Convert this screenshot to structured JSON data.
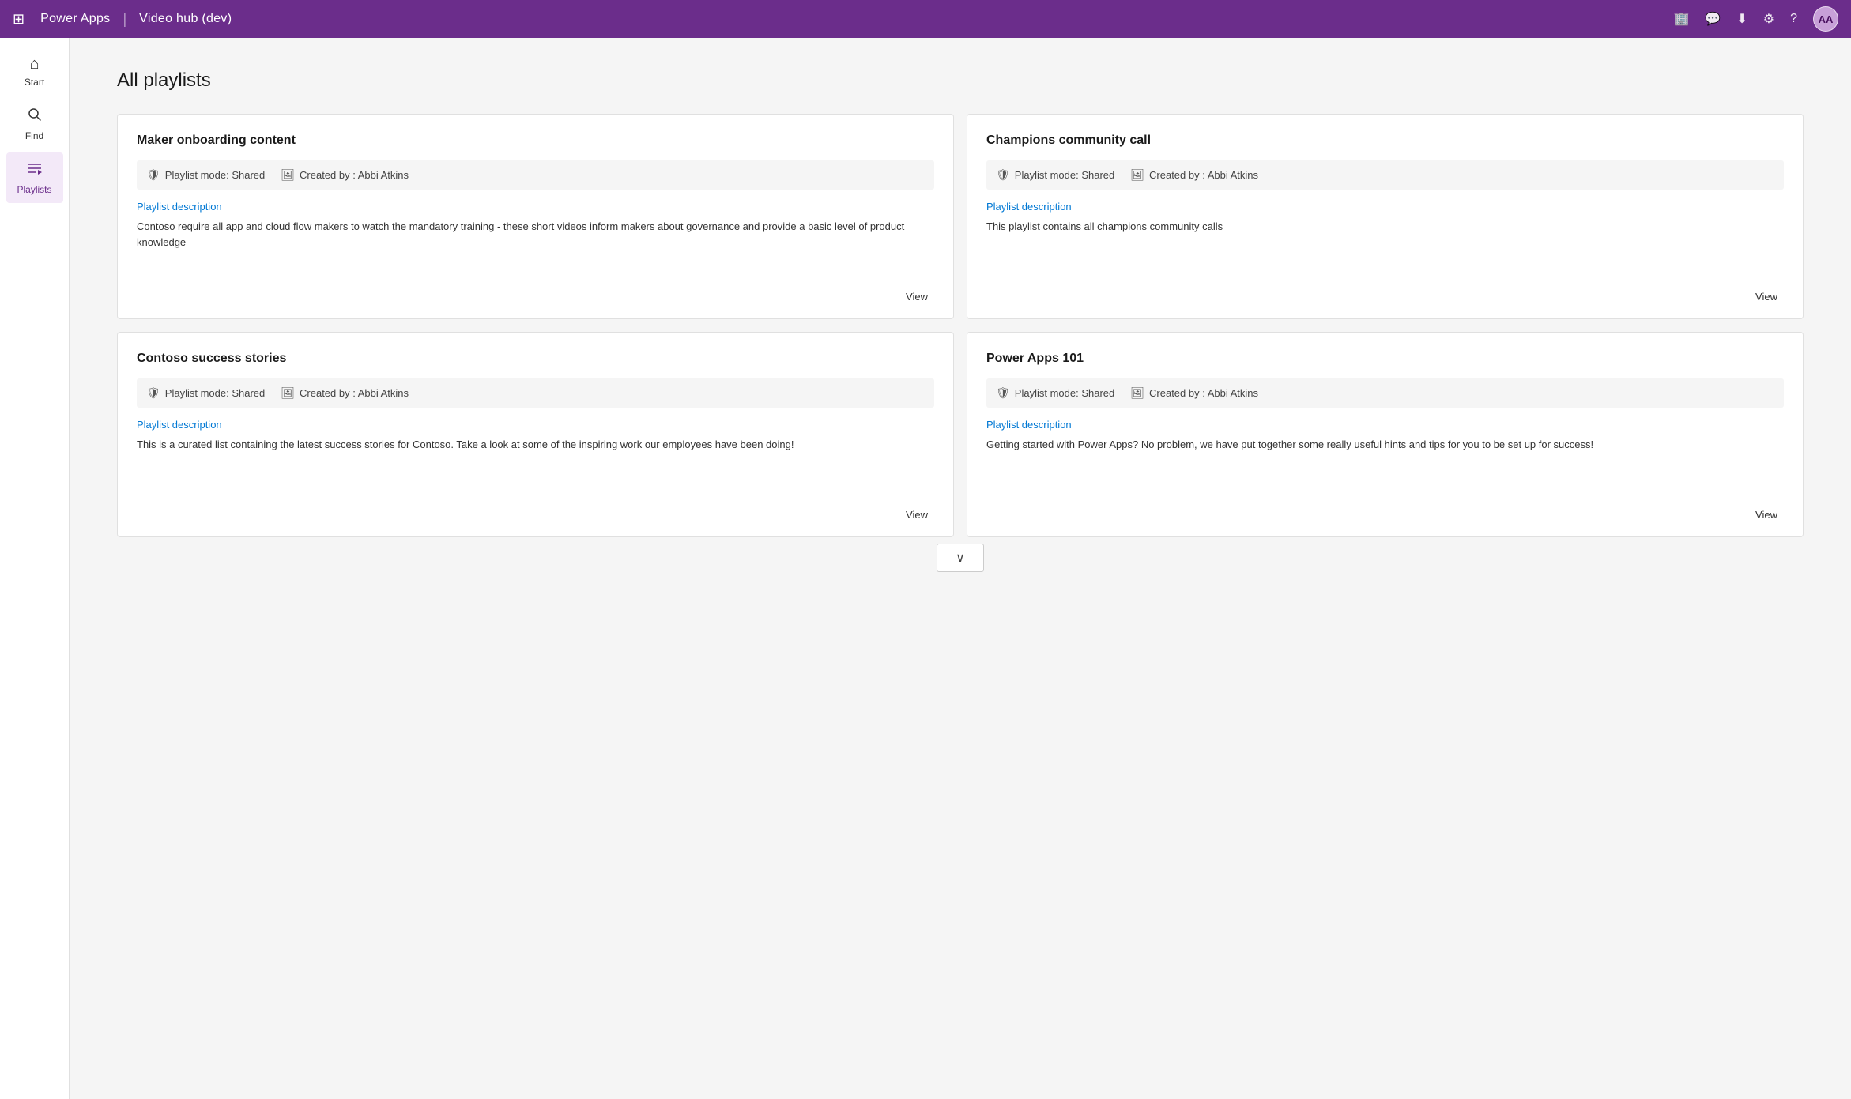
{
  "topnav": {
    "waffle_icon": "⊞",
    "app_name": "Power Apps",
    "separator": "|",
    "app_context": "Video hub (dev)",
    "icons": {
      "environment": "🏢",
      "chat": "💬",
      "download": "⬇",
      "settings": "⚙",
      "help": "?"
    },
    "avatar_label": "AA"
  },
  "sidebar": {
    "items": [
      {
        "id": "start",
        "label": "Start",
        "icon": "⌂",
        "active": false
      },
      {
        "id": "find",
        "label": "Find",
        "icon": "🔍",
        "active": false
      },
      {
        "id": "playlists",
        "label": "Playlists",
        "icon": "☰",
        "active": true
      }
    ]
  },
  "main": {
    "page_title": "All playlists",
    "playlists": [
      {
        "id": "maker-onboarding",
        "title": "Maker onboarding content",
        "playlist_mode_label": "Playlist mode: Shared",
        "created_by_label": "Created by : Abbi Atkins",
        "desc_label": "Playlist description",
        "description": "Contoso require all app and cloud flow makers to watch the mandatory training - these short videos inform makers about governance and provide a basic level of product knowledge",
        "view_label": "View"
      },
      {
        "id": "champions-community",
        "title": "Champions community call",
        "playlist_mode_label": "Playlist mode: Shared",
        "created_by_label": "Created by : Abbi Atkins",
        "desc_label": "Playlist description",
        "description": "This playlist contains all champions community calls",
        "view_label": "View"
      },
      {
        "id": "contoso-success",
        "title": "Contoso success stories",
        "playlist_mode_label": "Playlist mode: Shared",
        "created_by_label": "Created by : Abbi Atkins",
        "desc_label": "Playlist description",
        "description": "This is a curated list containing the latest success stories for Contoso.  Take a look at some of the inspiring work our employees have been doing!",
        "view_label": "View"
      },
      {
        "id": "power-apps-101",
        "title": "Power Apps 101",
        "playlist_mode_label": "Playlist mode: Shared",
        "created_by_label": "Created by : Abbi Atkins",
        "desc_label": "Playlist description",
        "description": "Getting started with Power Apps?  No problem, we have put together some really useful hints and tips for you to be set up for success!",
        "view_label": "View"
      }
    ],
    "load_more_icon": "∨"
  }
}
